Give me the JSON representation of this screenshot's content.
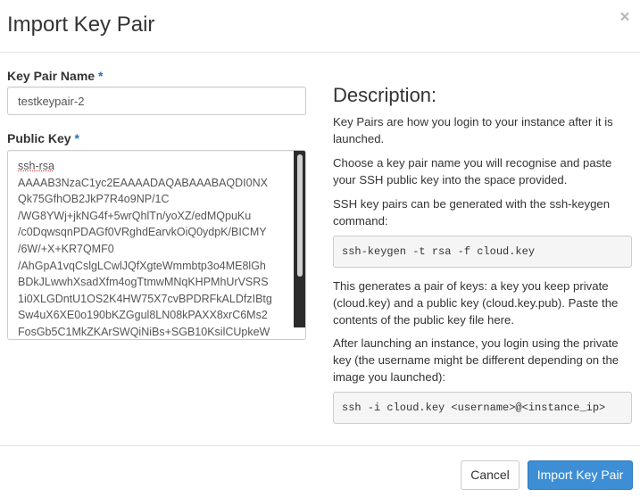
{
  "dialog": {
    "title": "Import Key Pair",
    "close_label": "×"
  },
  "form": {
    "key_pair_name": {
      "label": "Key Pair Name",
      "required_mark": "*",
      "value": "testkeypair-2"
    },
    "public_key": {
      "label": "Public Key",
      "required_mark": "*",
      "lines": [
        "ssh-rsa",
        "AAAAB3NzaC1yc2EAAAADAQABAAABAQDI0NX",
        "Qk75GfhOB2JkP7R4o9NP/1C",
        "/WG8YWj+jkNG4f+5wrQhlTn/yoXZ/edMQpuKu",
        "/c0DqwsqnPDAGf0VRghdEarvkOiQ0ydpK/BICMY",
        "/6W/+X+KR7QMF0",
        "/AhGpA1vqCslgLCwlJQfXgteWmmbtp3o4ME8lGh",
        "BDkJLwwhXsadXfm4ogTtmwMNqKHPMhUrVSRS",
        "1i0XLGDntU1OS2K4HW75X7cvBPDRFkALDfzIBtg",
        "Sw4uX6XE0o190bKZGgul8LN08kPAXX8xrC6Ms2",
        "FosGb5C1MkZKArSWQiNiBs+SGB10KsilCUpkeW"
      ]
    }
  },
  "description": {
    "title": "Description:",
    "paragraph_1": "Key Pairs are how you login to your instance after it is launched.",
    "paragraph_2": "Choose a key pair name you will recognise and paste your SSH public key into the space provided.",
    "paragraph_3": "SSH key pairs can be generated with the ssh-keygen command:",
    "code_1": "ssh-keygen -t rsa -f cloud.key",
    "paragraph_4": "This generates a pair of keys: a key you keep private (cloud.key) and a public key (cloud.key.pub). Paste the contents of the public key file here.",
    "paragraph_5": "After launching an instance, you login using the private key (the username might be different depending on the image you launched):",
    "code_2": "ssh -i cloud.key <username>@<instance_ip>"
  },
  "footer": {
    "cancel_label": "Cancel",
    "submit_label": "Import Key Pair"
  },
  "colors": {
    "primary": "#3d8ed4",
    "required": "#2a6fb8"
  }
}
